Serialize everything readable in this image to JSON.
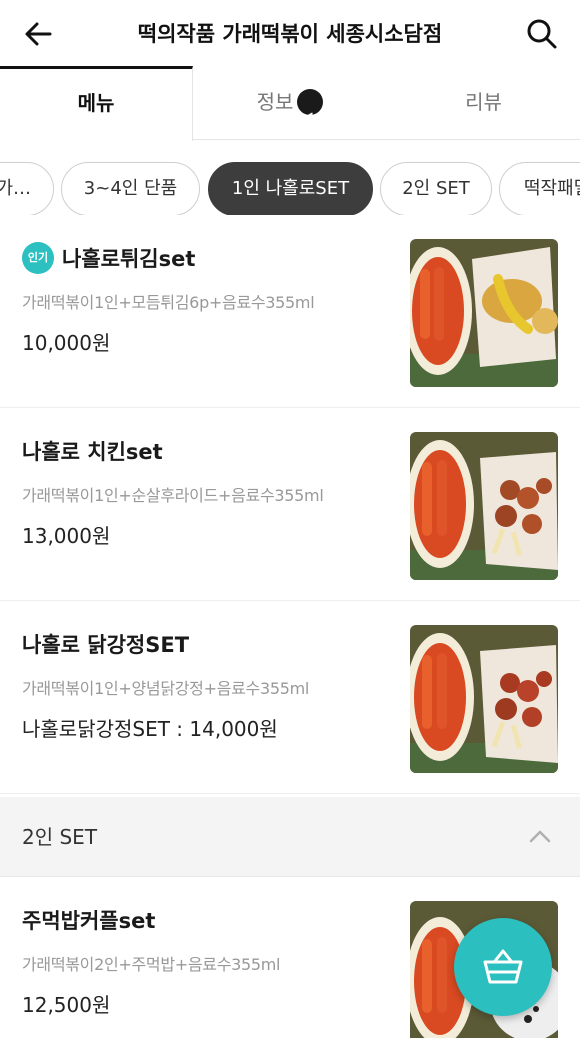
{
  "header": {
    "title": "떡의작품 가래떡볶이 세종시소담점",
    "back_icon": "arrow-left-icon",
    "search_icon": "search-icon"
  },
  "tabs": [
    {
      "label": "메뉴",
      "active": true
    },
    {
      "label": "정보",
      "active": false,
      "icon": "megaphone-icon"
    },
    {
      "label": "리뷰",
      "active": false
    }
  ],
  "categories": [
    {
      "label": "가…",
      "active": false
    },
    {
      "label": "3~4인 단품",
      "active": false
    },
    {
      "label": "1인 나홀로SET",
      "active": true
    },
    {
      "label": "2인 SET",
      "active": false
    },
    {
      "label": "떡작패밀",
      "active": false
    }
  ],
  "menu_items": [
    {
      "name": "나홀로튀김set",
      "badge": "인기",
      "desc": "가래떡볶이1인+모듬튀김6p+음료수355ml",
      "price": "10,000원"
    },
    {
      "name": "나홀로 치킨set",
      "desc": "가래떡볶이1인+순살후라이드+음료수355ml",
      "price": "13,000원"
    },
    {
      "name": "나홀로 닭강정SET",
      "desc": "가래떡볶이1인+양념닭강정+음료수355ml",
      "price": "나홀로닭강정SET : 14,000원"
    }
  ],
  "section": {
    "label": "2인 SET",
    "icon": "chevron-up-icon"
  },
  "section_items": [
    {
      "name": "주먹밥커플set",
      "desc": "가래떡볶이2인+주먹밥+음료수355ml",
      "price": "12,500원"
    }
  ],
  "fab": {
    "icon": "basket-icon"
  },
  "colors": {
    "accent": "#2cbfbf",
    "active_chip": "#3d3d3d"
  }
}
